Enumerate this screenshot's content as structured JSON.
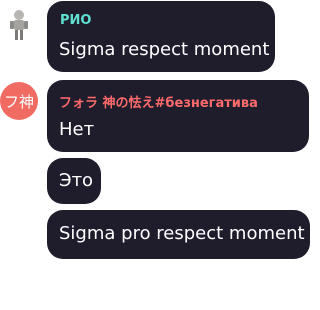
{
  "colors": {
    "bubble_bg": "#1f1c2c",
    "name_rio": "#5fe0d0",
    "name_fora": "#ff6b6b",
    "avatar_fora_bg": "#f06c63"
  },
  "messages": [
    {
      "author": "РИО",
      "text": "Sigma respect moment",
      "avatar_icon": "robot-figure-icon"
    },
    {
      "author": "フォラ 神の怯え#безнегатива",
      "text": "Нет",
      "avatar_text": "フ神"
    },
    {
      "text": "Это"
    },
    {
      "text": "Sigma pro respect moment"
    }
  ]
}
